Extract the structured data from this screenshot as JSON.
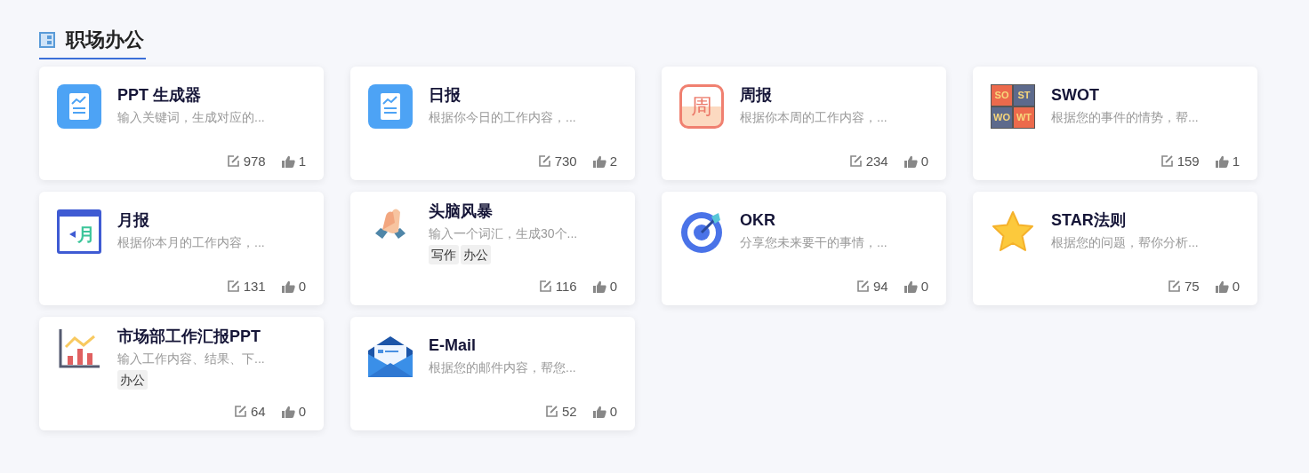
{
  "section": {
    "title": "职场办公"
  },
  "cards": [
    {
      "title": "PPT 生成器",
      "description": "输入关键词，生成对应的...",
      "icon": {
        "kind": "chart-doc"
      },
      "uses": "978",
      "likes": "1"
    },
    {
      "title": "日报",
      "description": "根据你今日的工作内容，...",
      "icon": {
        "kind": "chart-doc"
      },
      "uses": "730",
      "likes": "2"
    },
    {
      "title": "周报",
      "description": "根据你本周的工作内容，...",
      "icon": {
        "kind": "calendar-week",
        "glyphs": [
          "周"
        ]
      },
      "uses": "234",
      "likes": "0"
    },
    {
      "title": "SWOT",
      "description": "根据您的事件的情势，帮...",
      "icon": {
        "kind": "swot",
        "glyphs": [
          "SO",
          "ST",
          "WO",
          "WT"
        ]
      },
      "uses": "159",
      "likes": "1"
    },
    {
      "title": "月报",
      "description": "根据你本月的工作内容，...",
      "icon": {
        "kind": "calendar-month",
        "glyphs": [
          "月"
        ]
      },
      "uses": "131",
      "likes": "0"
    },
    {
      "title": "头脑风暴",
      "description": "输入一个词汇，生成30个...",
      "icon": {
        "kind": "handshake"
      },
      "tags": [
        "写作",
        "办公"
      ],
      "uses": "116",
      "likes": "0"
    },
    {
      "title": "OKR",
      "description": "分享您未来要干的事情，...",
      "icon": {
        "kind": "target"
      },
      "uses": "94",
      "likes": "0"
    },
    {
      "title": "STAR法则",
      "description": "根据您的问题，帮你分析...",
      "icon": {
        "kind": "star"
      },
      "uses": "75",
      "likes": "0"
    },
    {
      "title": "市场部工作汇报PPT",
      "description": "输入工作内容、结果、下...",
      "icon": {
        "kind": "bar-chart"
      },
      "tags": [
        "办公"
      ],
      "uses": "64",
      "likes": "0"
    },
    {
      "title": "E-Mail",
      "description": "根据您的邮件内容，帮您...",
      "icon": {
        "kind": "envelope"
      },
      "uses": "52",
      "likes": "0"
    }
  ]
}
